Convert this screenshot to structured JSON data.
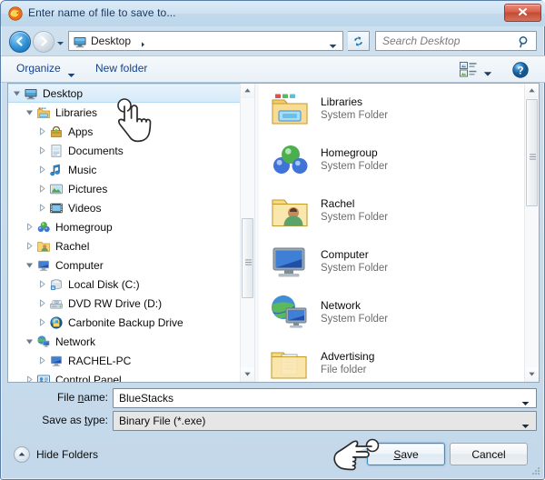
{
  "window": {
    "title": "Enter name of file to save to...",
    "app_icon": "firefox-icon",
    "close_label": "x"
  },
  "navbar": {
    "back_icon": "back-arrow-icon",
    "forward_icon": "forward-arrow-icon",
    "history_icon": "chevron-down-icon",
    "address": {
      "icon": "desktop-icon",
      "crumb": "Desktop",
      "separator_icon": "chevron-right-icon",
      "dropdown_icon": "chevron-down-icon"
    },
    "refresh_icon": "refresh-icon",
    "search": {
      "placeholder": "Search Desktop",
      "icon": "search-icon"
    }
  },
  "toolbar": {
    "organize_label": "Organize",
    "organize_arrow_icon": "chevron-down-icon",
    "new_folder_label": "New folder",
    "views_icon": "views-icon",
    "views_arrow_icon": "chevron-down-icon",
    "help_icon": "help-icon"
  },
  "tree": {
    "items": [
      {
        "label": "Desktop",
        "indent": 0,
        "twisty": "expanded",
        "icon": "desktop-icon",
        "selected": true
      },
      {
        "label": "Libraries",
        "indent": 1,
        "twisty": "expanded",
        "icon": "libraries-icon",
        "selected": false
      },
      {
        "label": "Apps",
        "indent": 2,
        "twisty": "collapsed",
        "icon": "apps-icon",
        "selected": false
      },
      {
        "label": "Documents",
        "indent": 2,
        "twisty": "collapsed",
        "icon": "documents-icon",
        "selected": false
      },
      {
        "label": "Music",
        "indent": 2,
        "twisty": "collapsed",
        "icon": "music-icon",
        "selected": false
      },
      {
        "label": "Pictures",
        "indent": 2,
        "twisty": "collapsed",
        "icon": "pictures-icon",
        "selected": false
      },
      {
        "label": "Videos",
        "indent": 2,
        "twisty": "collapsed",
        "icon": "videos-icon",
        "selected": false
      },
      {
        "label": "Homegroup",
        "indent": 1,
        "twisty": "collapsed",
        "icon": "homegroup-icon",
        "selected": false
      },
      {
        "label": "Rachel",
        "indent": 1,
        "twisty": "collapsed",
        "icon": "user-folder-icon",
        "selected": false
      },
      {
        "label": "Computer",
        "indent": 1,
        "twisty": "expanded",
        "icon": "computer-icon",
        "selected": false
      },
      {
        "label": "Local Disk (C:)",
        "indent": 2,
        "twisty": "collapsed",
        "icon": "hard-disk-icon",
        "selected": false
      },
      {
        "label": "DVD RW Drive (D:)",
        "indent": 2,
        "twisty": "collapsed",
        "icon": "dvd-drive-icon",
        "selected": false
      },
      {
        "label": "Carbonite Backup Drive",
        "indent": 2,
        "twisty": "collapsed",
        "icon": "backup-drive-icon",
        "selected": false
      },
      {
        "label": "Network",
        "indent": 1,
        "twisty": "expanded",
        "icon": "network-icon",
        "selected": false
      },
      {
        "label": "RACHEL-PC",
        "indent": 2,
        "twisty": "collapsed",
        "icon": "computer-icon",
        "selected": false
      },
      {
        "label": "Control Panel",
        "indent": 1,
        "twisty": "collapsed",
        "icon": "control-panel-icon",
        "selected": false
      }
    ],
    "scrollbar": {
      "up_icon": "scroll-up-icon",
      "down_icon": "scroll-down-icon"
    }
  },
  "filelist": {
    "items": [
      {
        "name": "Libraries",
        "subtitle": "System Folder",
        "icon": "libraries-folder-icon"
      },
      {
        "name": "Homegroup",
        "subtitle": "System Folder",
        "icon": "homegroup-icon"
      },
      {
        "name": "Rachel",
        "subtitle": "System Folder",
        "icon": "user-folder-icon"
      },
      {
        "name": "Computer",
        "subtitle": "System Folder",
        "icon": "computer-icon"
      },
      {
        "name": "Network",
        "subtitle": "System Folder",
        "icon": "network-icon"
      },
      {
        "name": "Advertising",
        "subtitle": "File folder",
        "icon": "file-folder-icon"
      }
    ],
    "scrollbar": {
      "up_icon": "scroll-up-icon",
      "down_icon": "scroll-down-icon"
    }
  },
  "fields": {
    "filename": {
      "label_pre": "File ",
      "label_acc": "n",
      "label_post": "ame:",
      "value": "BlueStacks",
      "dropdown_icon": "chevron-down-icon"
    },
    "filetype": {
      "label_pre": "Save as ",
      "label_acc": "t",
      "label_post": "ype:",
      "value": "Binary File (*.exe)",
      "dropdown_icon": "chevron-down-icon"
    }
  },
  "footer": {
    "hide_folders_label": "Hide Folders",
    "hide_folders_icon": "chevron-up-circle-icon",
    "save": {
      "pre": "",
      "acc": "S",
      "post": "ave"
    },
    "cancel_label": "Cancel",
    "resize_grip_icon": "resize-grip-icon"
  },
  "cursors": {
    "tree_hand": "pointing-hand-cursor",
    "save_hand": "pointing-hand-cursor"
  },
  "colors": {
    "accent": "#15428b",
    "frame": "#5b7fa6",
    "close": "#c44a36",
    "selection": "#d6ebf9"
  }
}
